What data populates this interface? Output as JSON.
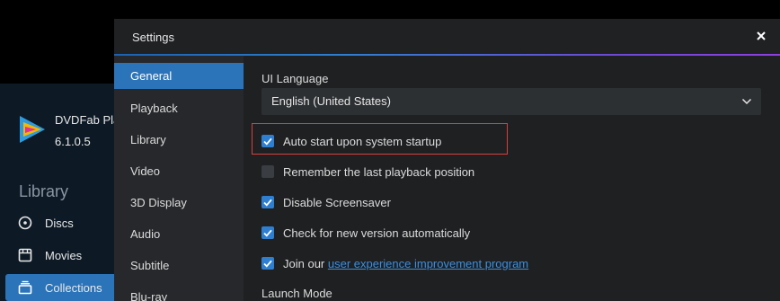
{
  "app": {
    "name": "DVDFab Pla",
    "version": "6.1.0.5",
    "library_heading": "Library",
    "nav": [
      {
        "label": "Discs",
        "icon": "disc-icon",
        "active": false
      },
      {
        "label": "Movies",
        "icon": "movie-icon",
        "active": false
      },
      {
        "label": "Collections",
        "icon": "collections-icon",
        "active": true
      }
    ]
  },
  "dialog": {
    "title": "Settings",
    "close_icon": "close-icon",
    "nav": [
      "General",
      "Playback",
      "Library",
      "Video",
      "3D Display",
      "Audio",
      "Subtitle",
      "Blu-ray"
    ],
    "active_nav": "General",
    "ui_language": {
      "label": "UI Language",
      "value": "English (United States)"
    },
    "options": [
      {
        "label": "Auto start upon system startup",
        "checked": true
      },
      {
        "label": "Remember the last playback position",
        "checked": false
      },
      {
        "label": "Disable Screensaver",
        "checked": true
      },
      {
        "label": "Check for new version automatically",
        "checked": true
      },
      {
        "label": "Join our",
        "link": "user experience improvement program",
        "checked": true
      }
    ],
    "launch_mode_label": "Launch Mode"
  },
  "colors": {
    "accent": "#2c74b9",
    "checkbox": "#2f7fd1",
    "highlight": "#d84040",
    "link": "#3b8fe0"
  }
}
